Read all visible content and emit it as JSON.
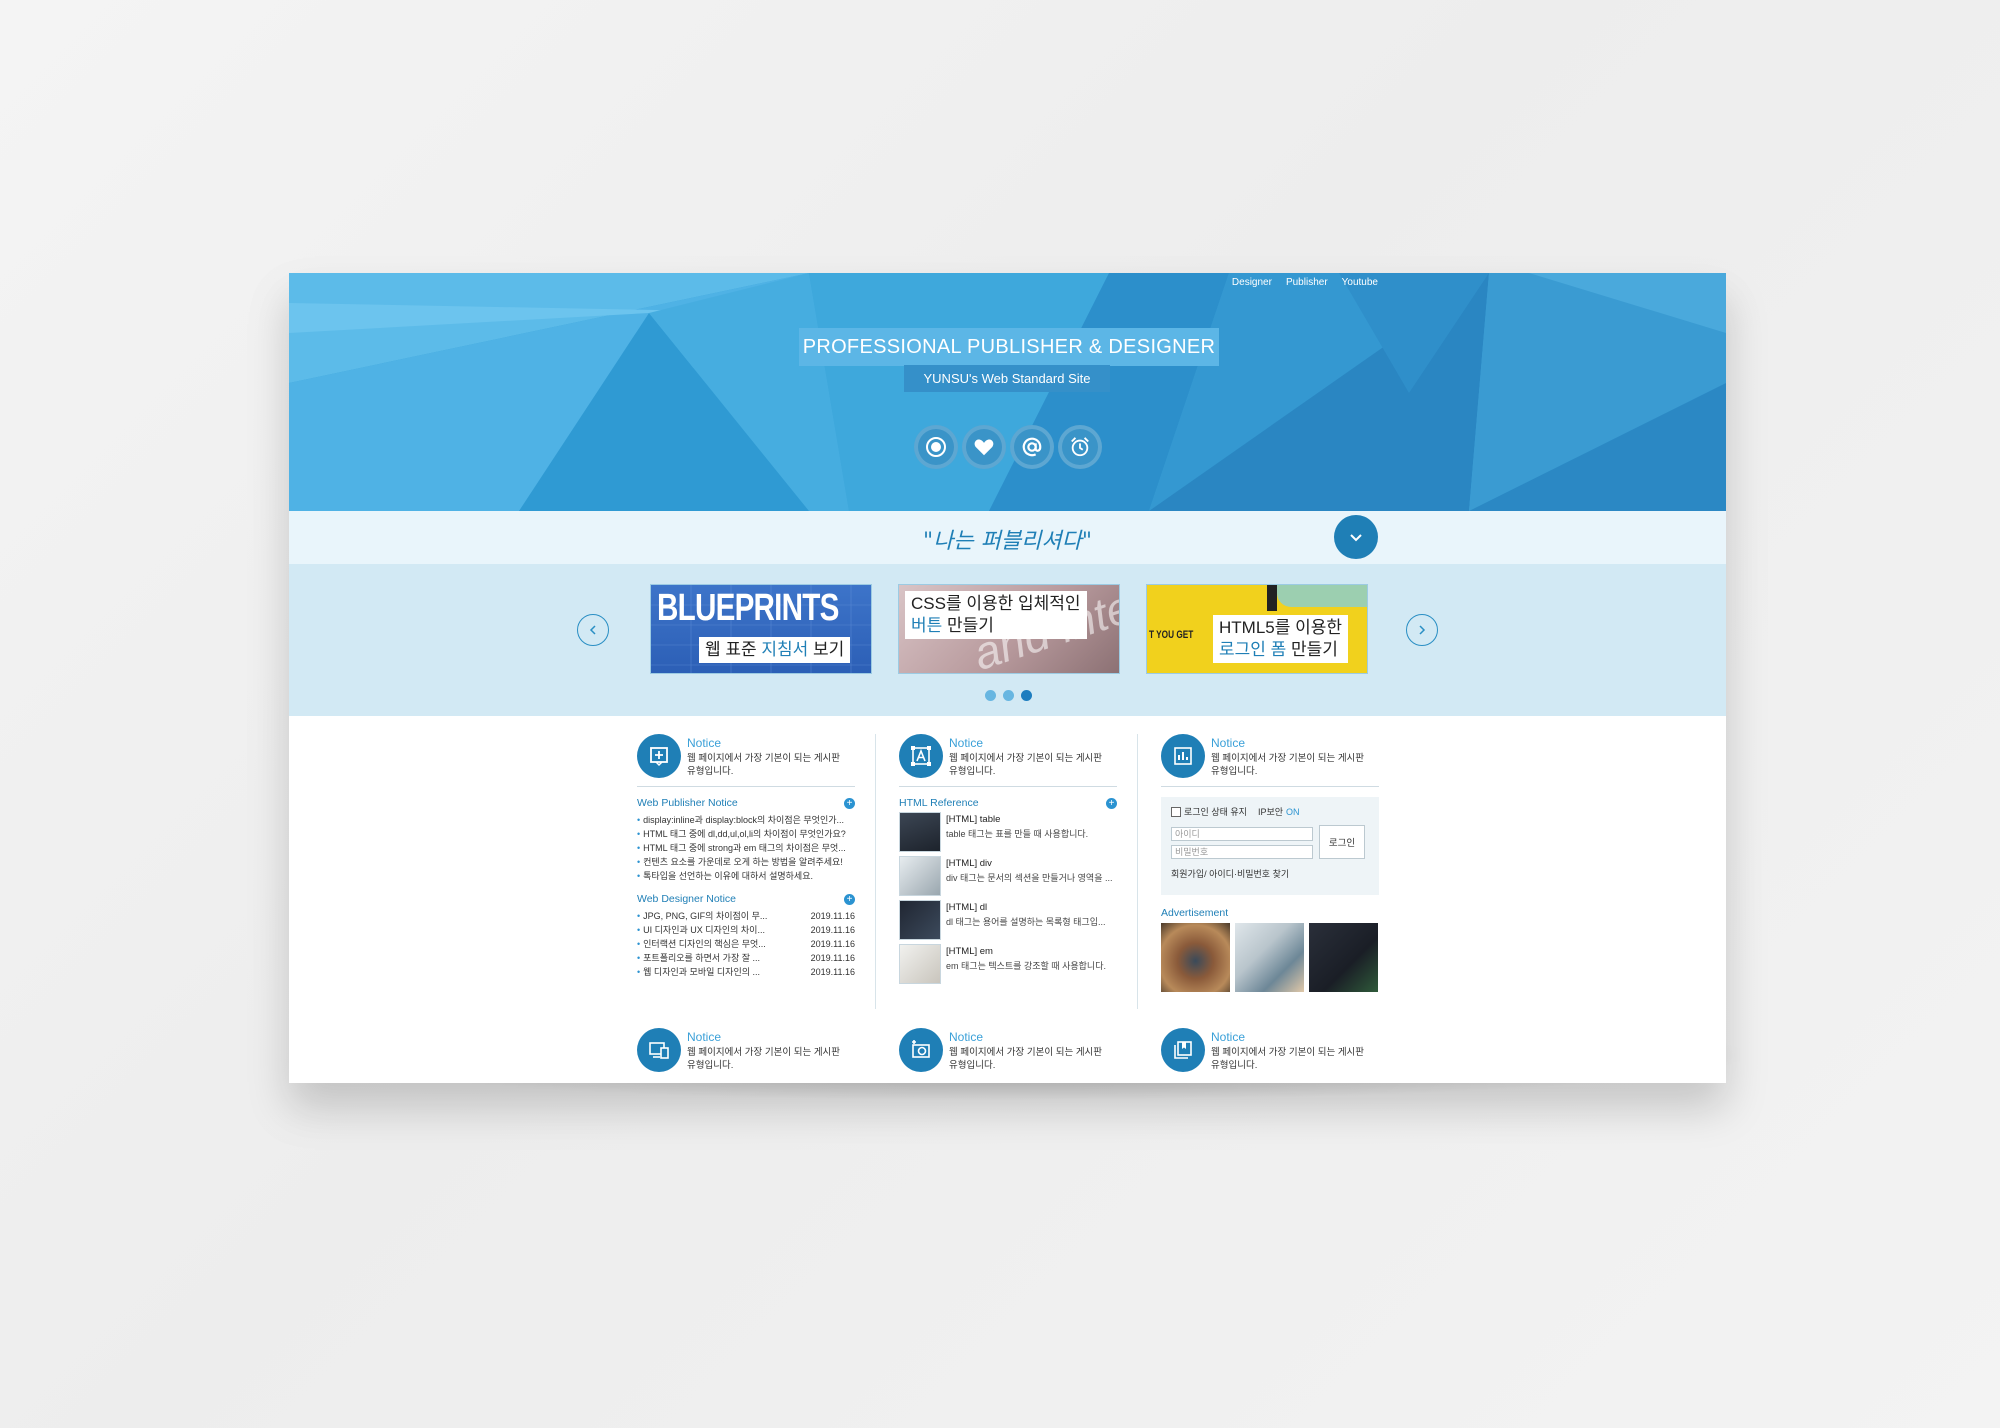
{
  "topnav": [
    "Designer",
    "Publisher",
    "Youtube"
  ],
  "hero": {
    "title": "PROFESSIONAL PUBLISHER & DESIGNER",
    "subtitle": "YUNSU's Web Standard Site",
    "icons": [
      "target-icon",
      "heart-icon",
      "at-icon",
      "alarm-icon"
    ]
  },
  "slogan": "\"나는 퍼블리셔다\"",
  "slider": {
    "slides": [
      {
        "banner": "BLUEPRINTS",
        "caption_a": "웹 표준 ",
        "caption_b": "지침서",
        "caption_c": " 보기"
      },
      {
        "banner": "and inte",
        "caption_line1": "CSS를 이용한 입체적인",
        "caption_b": "버튼",
        "caption_c": " 만들기"
      },
      {
        "banner": "T YOU GET",
        "caption_line1": "HTML5를 이용한",
        "caption_b": "로그인 폼",
        "caption_c": " 만들기"
      }
    ],
    "active_dot": 3,
    "dot_count": 3
  },
  "notice": {
    "title": "Notice",
    "desc_line1": "웹 페이지에서 가장 기본이 되는 게시판",
    "desc_line2": "유형입니다."
  },
  "publisher_notice": {
    "title": "Web Publisher Notice",
    "items": [
      "display:inline과 display:block의 차이점은 무엇인가...",
      "HTML 태그 중에 dl,dd,ul,ol,li의 차이점이 무엇인가요?",
      "HTML 태그 중에 strong과 em 태그의 차이점은 무엇...",
      "컨텐츠 요소를 가운데로 오게 하는 방법을 알려주세요!",
      "톡타입을 선언하는 이유에 대하서 설명하세요."
    ]
  },
  "designer_notice": {
    "title": "Web Designer Notice",
    "items": [
      {
        "text": "JPG, PNG, GIF의 차이점이 무...",
        "date": "2019.11.16"
      },
      {
        "text": "UI 디자인과 UX 디자인의 차이...",
        "date": "2019.11.16"
      },
      {
        "text": "인터랙션 디자인의 핵심은 무엇...",
        "date": "2019.11.16"
      },
      {
        "text": "포트폴리오를 하면서 가장 잘 ...",
        "date": "2019.11.16"
      },
      {
        "text": "웹 디자인과 모바일 디자인의 ...",
        "date": "2019.11.16"
      }
    ]
  },
  "html_reference": {
    "title": "HTML Reference",
    "items": [
      {
        "title": "[HTML] table",
        "desc": "table 태그는 표를 만들 때 사용합니다."
      },
      {
        "title": "[HTML] div",
        "desc": "div 태그는 문서의 섹션을 만들거나 영역을 ..."
      },
      {
        "title": "[HTML] dl",
        "desc": "dl 태그는 용어를 설명하는 목록형 태그입..."
      },
      {
        "title": "[HTML] em",
        "desc": "em 태그는 텍스트를 강조할 때 사용합니다."
      }
    ]
  },
  "login": {
    "keep": "로그인 상태 유지",
    "ip_label": "IP보안",
    "ip_value": "ON",
    "id_placeholder": "아이디",
    "pw_placeholder": "비밀번호",
    "button": "로그인",
    "footer": "회원가입/ 아이디·비밀번호 찾기"
  },
  "advertisement": {
    "title": "Advertisement"
  },
  "colors": {
    "brand": "#1f7fb6",
    "hero": "#3aa3d8",
    "accent": "#2b93d1"
  }
}
